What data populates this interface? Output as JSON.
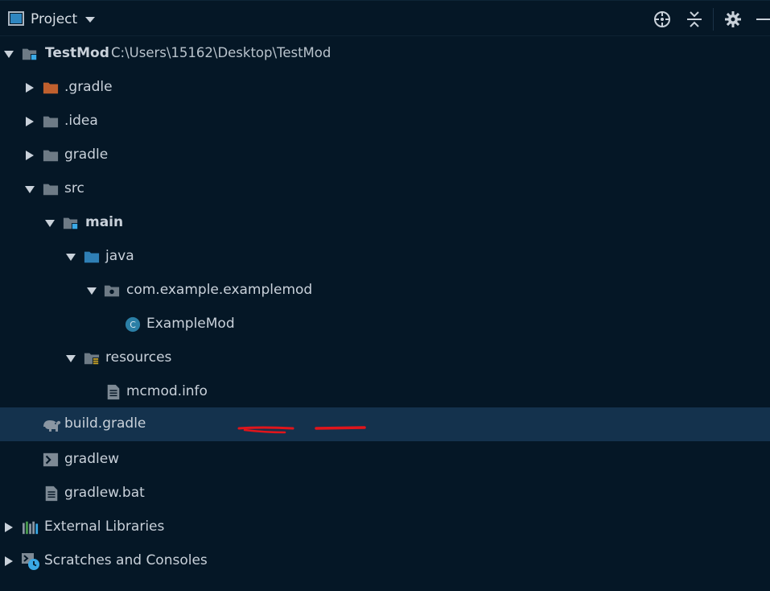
{
  "panel": {
    "title": "Project",
    "icons": [
      "project-view-icon",
      "dropdown-caret-icon",
      "locate-icon",
      "collapse-all-icon",
      "gear-icon",
      "minimize-icon"
    ]
  },
  "tree": {
    "root_name": "TestMod",
    "root_path": "C:\\Users\\15162\\Desktop\\TestMod",
    "items": {
      "gradle_hidden": ".gradle",
      "idea": ".idea",
      "gradle": "gradle",
      "src": "src",
      "main": "main",
      "java": "java",
      "package": "com.example.examplemod",
      "example_mod": "ExampleMod",
      "resources": "resources",
      "mcmod": "mcmod.info",
      "build_gradle": "build.gradle",
      "gradlew": "gradlew",
      "gradlew_bat": "gradlew.bat",
      "external_libraries": "External Libraries",
      "scratches": "Scratches and Consoles"
    },
    "selected_item": "build.gradle"
  },
  "colors": {
    "background": "#051726",
    "selection": "#14324d",
    "folder": "#6e7b86",
    "folder_orange": "#c0602e",
    "folder_blue": "#2f7fb5",
    "module_badge": "#3aa9e6",
    "class_icon": "#2b7fa6",
    "annotation_red": "#e0151b"
  }
}
